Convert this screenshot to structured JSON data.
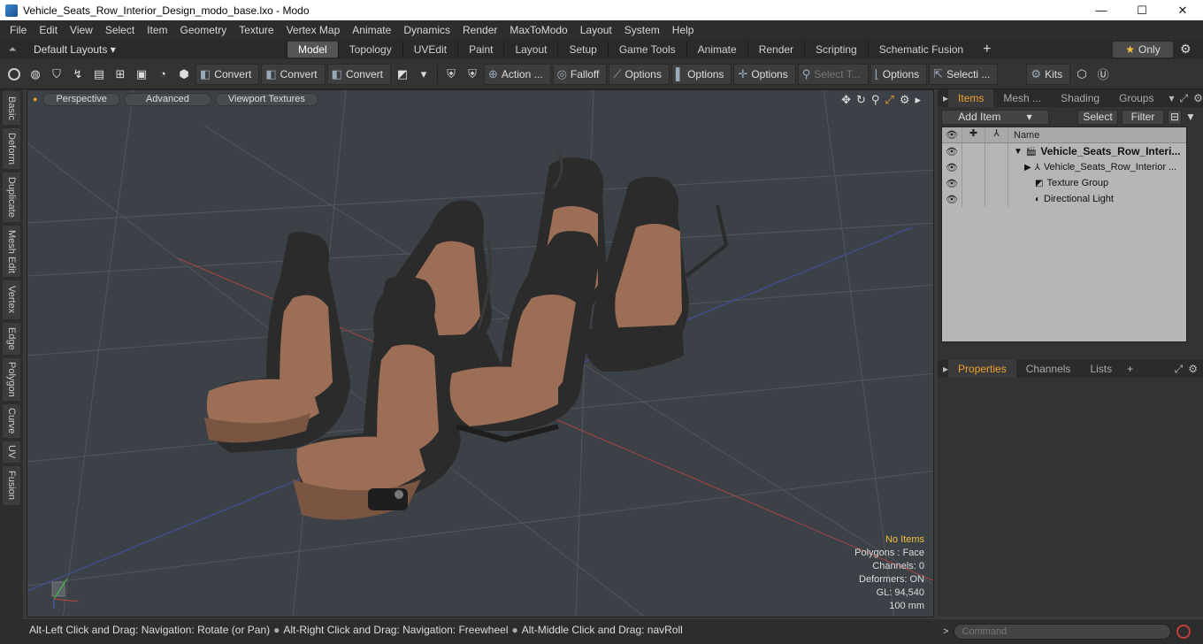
{
  "window": {
    "title": "Vehicle_Seats_Row_Interior_Design_modo_base.lxo - Modo",
    "minimize": "—",
    "maximize": "☐",
    "close": "✕"
  },
  "menu": [
    "File",
    "Edit",
    "View",
    "Select",
    "Item",
    "Geometry",
    "Texture",
    "Vertex Map",
    "Animate",
    "Dynamics",
    "Render",
    "MaxToModo",
    "Layout",
    "System",
    "Help"
  ],
  "layout": {
    "layouts_label": "Default Layouts ▾",
    "tabs": [
      "Model",
      "Topology",
      "UVEdit",
      "Paint",
      "Layout",
      "Setup",
      "Game Tools",
      "Animate",
      "Render",
      "Scripting",
      "Schematic Fusion"
    ],
    "active_tab": "Model",
    "only_label": "Only"
  },
  "toolbar": {
    "convert1": "Convert",
    "convert2": "Convert",
    "convert3": "Convert",
    "action": "Action ...",
    "falloff": "Falloff",
    "options1": "Options",
    "options2": "Options",
    "options3": "Options",
    "select_t": "Select T...",
    "options4": "Options",
    "selecti": "Selecti ...",
    "kits": "Kits"
  },
  "left_tabs": [
    "Basic",
    "Deform",
    "Duplicate",
    "Mesh Edit",
    "Vertex",
    "Edge",
    "Polygon",
    "Curve",
    "UV",
    "Fusion"
  ],
  "viewport": {
    "perspective": "Perspective",
    "advanced": "Advanced",
    "textures": "Viewport Textures",
    "info": {
      "selection": "No Items",
      "polygons": "Polygons : Face",
      "channels": "Channels: 0",
      "deformers": "Deformers: ON",
      "gl": "GL: 94,540",
      "scale": "100 mm"
    }
  },
  "status": {
    "hint1": "Alt-Left Click and Drag: Navigation: Rotate (or Pan)",
    "hint2": "Alt-Right Click and Drag: Navigation: Freewheel",
    "hint3": "Alt-Middle Click and Drag: navRoll"
  },
  "items_panel": {
    "tabs": [
      "Items",
      "Mesh ...",
      "Shading",
      "Groups"
    ],
    "add_item": "Add Item",
    "select": "Select",
    "filter": "Filter",
    "name_header": "Name",
    "rows": [
      {
        "name": "Vehicle_Seats_Row_Interi..."
      },
      {
        "name": "Vehicle_Seats_Row_Interior ..."
      },
      {
        "name": "Texture Group"
      },
      {
        "name": "Directional Light"
      }
    ]
  },
  "props_panel": {
    "tabs": [
      "Properties",
      "Channels",
      "Lists"
    ]
  },
  "command": {
    "placeholder": "Command"
  },
  "colors": {
    "accent": "#f0a030",
    "seat_leather": "#9c6e55",
    "seat_black": "#2b2b2b",
    "viewport_bg": "#3b4146"
  }
}
